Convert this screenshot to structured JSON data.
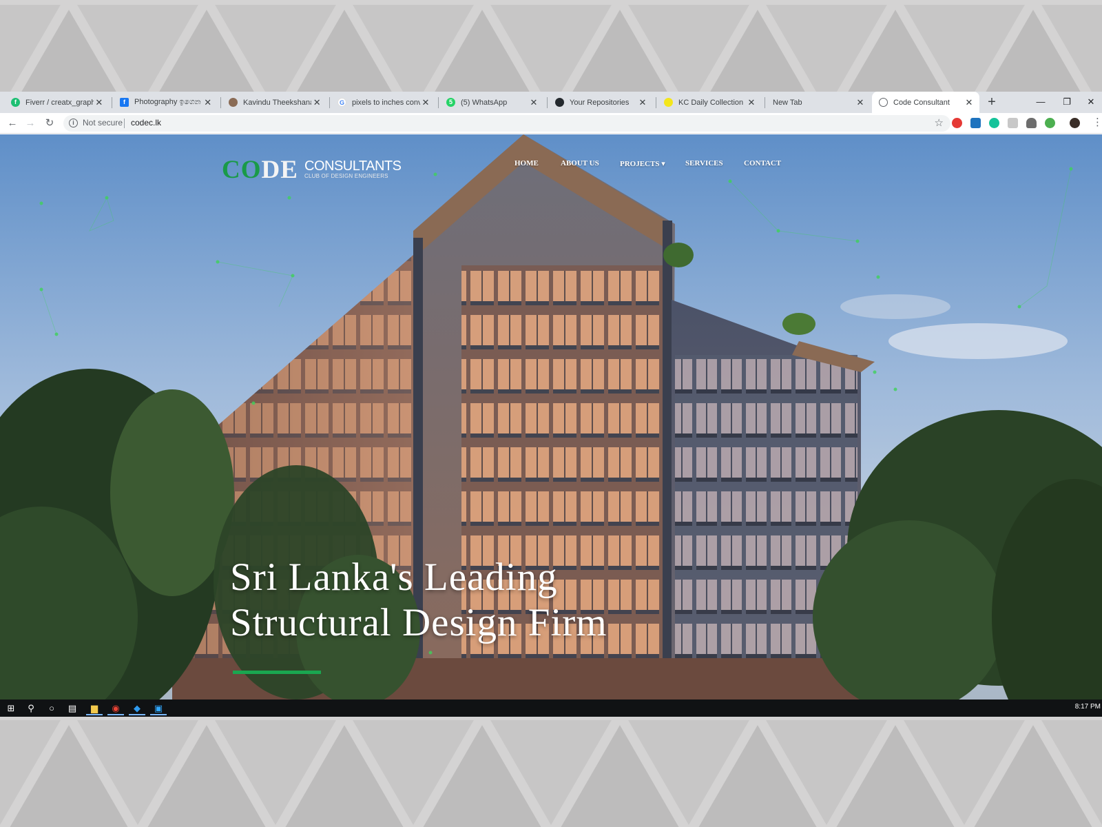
{
  "browser": {
    "tabs": [
      {
        "title": "Fiverr / creatx_graphic",
        "icon": "fiverr-icon",
        "color": "#1dbf73"
      },
      {
        "title": "Photography ඉගෙන ග",
        "icon": "facebook-icon",
        "color": "#1877f2"
      },
      {
        "title": "Kavindu Theekshana H",
        "icon": "profile-icon",
        "color": "#8a6b55"
      },
      {
        "title": "pixels to inches conver",
        "icon": "google-icon",
        "color": "#4285f4"
      },
      {
        "title": "(5) WhatsApp",
        "icon": "whatsapp-icon",
        "color": "#25d366"
      },
      {
        "title": "Your Repositories",
        "icon": "github-icon",
        "color": "#24292e"
      },
      {
        "title": "KC Daily Collection",
        "icon": "dot-icon",
        "color": "#f4e61b"
      },
      {
        "title": "New Tab",
        "icon": "",
        "color": ""
      },
      {
        "title": "Code Consultant",
        "icon": "globe-icon",
        "color": "#5f6368"
      }
    ],
    "new_tab_label": "+",
    "window_controls": {
      "minimize": "—",
      "restore": "❐",
      "close": "✕"
    },
    "address": {
      "security_label": "Not secure",
      "url": "codec.lk"
    }
  },
  "website": {
    "logo": {
      "code_part1": "CO",
      "code_part2": "DE",
      "consultants": "CONSULTANTS",
      "tagline": "CLUB OF DESIGN ENGINEERS"
    },
    "nav": [
      "HOME",
      "ABOUT US",
      "PROJECTS ▾",
      "SERVICES",
      "CONTACT"
    ],
    "headline": [
      "Sri Lanka's Leading",
      "Structural Design Firm"
    ],
    "accent_color": "#1aa650"
  },
  "taskbar": {
    "clock": "8:17 PM"
  }
}
